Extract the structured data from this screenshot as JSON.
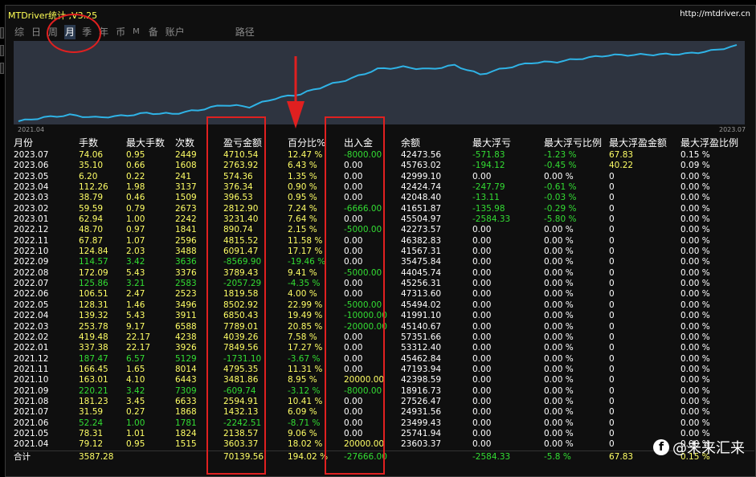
{
  "window": {
    "title": "MTDriver统计 ,V3.25",
    "site": "http://mtdriver.cn"
  },
  "tabs": [
    "综",
    "日",
    "周",
    "月",
    "季",
    "年",
    "币",
    "M",
    "备",
    "账户",
    "路径"
  ],
  "active_tab": "月",
  "chart": {
    "x_start_label": "2021.04",
    "x_end_label": "2023.07",
    "line_color": "#2fb3e6"
  },
  "table": {
    "headers": [
      "月份",
      "手数",
      "最大手数",
      "次数",
      "盈亏金额",
      "百分比%",
      "出入金",
      "余额",
      "最大浮亏",
      "最大浮亏比例",
      "最大浮盈金额",
      "最大浮盈比例"
    ],
    "rows": [
      [
        "2023.07",
        "74.06",
        "0.95",
        "2449",
        "4710.54",
        "12.47 %",
        "-8000.00",
        "42473.56",
        "-571.83",
        "-1.23 %",
        "67.83",
        "0.15 %"
      ],
      [
        "2023.06",
        "35.10",
        "0.66",
        "1608",
        "2763.92",
        "6.43 %",
        "0.00",
        "45763.02",
        "-194.12",
        "-0.45 %",
        "40.22",
        "0.09 %"
      ],
      [
        "2023.05",
        "6.20",
        "0.22",
        "241",
        "574.36",
        "1.35 %",
        "0.00",
        "42999.10",
        "0.00",
        "0.00 %",
        "0",
        "0.00 %"
      ],
      [
        "2023.04",
        "112.26",
        "1.98",
        "3137",
        "376.34",
        "0.90 %",
        "0.00",
        "42424.74",
        "-247.79",
        "-0.61 %",
        "0",
        "0.00 %"
      ],
      [
        "2023.03",
        "38.79",
        "0.46",
        "1509",
        "396.53",
        "0.95 %",
        "0.00",
        "42048.40",
        "-13.11",
        "-0.03 %",
        "0",
        "0.00 %"
      ],
      [
        "2023.02",
        "59.59",
        "0.79",
        "2673",
        "2812.90",
        "7.24 %",
        "-6666.00",
        "41651.87",
        "-135.98",
        "-0.29 %",
        "0",
        "0.00 %"
      ],
      [
        "2023.01",
        "62.94",
        "1.00",
        "2242",
        "3231.40",
        "7.64 %",
        "0.00",
        "45504.97",
        "-2584.33",
        "-5.80 %",
        "0",
        "0.00 %"
      ],
      [
        "2022.12",
        "48.70",
        "0.97",
        "1841",
        "890.74",
        "2.15 %",
        "-5000.00",
        "42273.57",
        "0.00",
        "0.00 %",
        "0",
        "0.00 %"
      ],
      [
        "2022.11",
        "67.87",
        "1.07",
        "2596",
        "4815.52",
        "11.58 %",
        "0.00",
        "46382.83",
        "0.00",
        "0.00 %",
        "0",
        "0.00 %"
      ],
      [
        "2022.10",
        "124.84",
        "2.03",
        "3488",
        "6091.47",
        "17.17 %",
        "0.00",
        "41567.31",
        "0.00",
        "0.00 %",
        "0",
        "0.00 %"
      ],
      [
        "2022.09",
        "114.57",
        "3.42",
        "3636",
        "-8569.90",
        "-19.46 %",
        "0.00",
        "35475.84",
        "0.00",
        "0.00 %",
        "0",
        "0.00 %"
      ],
      [
        "2022.08",
        "172.09",
        "5.43",
        "3376",
        "3789.43",
        "9.41 %",
        "-5000.00",
        "44045.74",
        "0.00",
        "0.00 %",
        "0",
        "0.00 %"
      ],
      [
        "2022.07",
        "125.86",
        "3.21",
        "2583",
        "-2057.29",
        "-4.35 %",
        "0.00",
        "45256.31",
        "0.00",
        "0.00 %",
        "0",
        "0.00 %"
      ],
      [
        "2022.06",
        "106.51",
        "2.47",
        "2523",
        "1819.58",
        "4.00 %",
        "0.00",
        "47313.60",
        "0.00",
        "0.00 %",
        "0",
        "0.00 %"
      ],
      [
        "2022.05",
        "128.31",
        "1.46",
        "3496",
        "8502.92",
        "22.99 %",
        "-5000.00",
        "45494.02",
        "0.00",
        "0.00 %",
        "0",
        "0.00 %"
      ],
      [
        "2022.04",
        "139.32",
        "5.43",
        "3911",
        "6850.43",
        "19.49 %",
        "-10000.00",
        "41991.10",
        "0.00",
        "0.00 %",
        "0",
        "0.00 %"
      ],
      [
        "2022.03",
        "253.78",
        "9.17",
        "6588",
        "7789.01",
        "20.85 %",
        "-20000.00",
        "45140.67",
        "0.00",
        "0.00 %",
        "0",
        "0.00 %"
      ],
      [
        "2022.02",
        "419.48",
        "22.17",
        "4238",
        "4039.26",
        "7.58 %",
        "0.00",
        "57351.66",
        "0.00",
        "0.00 %",
        "0",
        "0.00 %"
      ],
      [
        "2022.01",
        "337.38",
        "22.17",
        "3926",
        "7849.56",
        "17.27 %",
        "0.00",
        "53312.40",
        "0.00",
        "0.00 %",
        "0",
        "0.00 %"
      ],
      [
        "2021.12",
        "187.47",
        "6.57",
        "5129",
        "-1731.10",
        "-3.67 %",
        "0.00",
        "45462.84",
        "0.00",
        "0.00 %",
        "0",
        "0.00 %"
      ],
      [
        "2021.11",
        "166.45",
        "1.65",
        "8014",
        "4795.35",
        "11.31 %",
        "0.00",
        "47193.94",
        "0.00",
        "0.00 %",
        "0",
        "0.00 %"
      ],
      [
        "2021.10",
        "163.01",
        "4.10",
        "6443",
        "3481.86",
        "8.95 %",
        "20000.00",
        "42398.59",
        "0.00",
        "0.00 %",
        "0",
        "0.00 %"
      ],
      [
        "2021.09",
        "220.21",
        "3.42",
        "7309",
        "-609.74",
        "-3.12 %",
        "-8000.00",
        "18916.73",
        "0.00",
        "0.00 %",
        "0",
        "0.00 %"
      ],
      [
        "2021.08",
        "181.23",
        "3.45",
        "6633",
        "2594.91",
        "10.41 %",
        "0.00",
        "27526.47",
        "0.00",
        "0.00 %",
        "0",
        "0.00 %"
      ],
      [
        "2021.07",
        "31.59",
        "0.27",
        "1868",
        "1432.13",
        "6.09 %",
        "0.00",
        "24931.56",
        "0.00",
        "0.00 %",
        "0",
        "0.00 %"
      ],
      [
        "2021.06",
        "52.24",
        "1.00",
        "1781",
        "-2242.51",
        "-8.71 %",
        "0.00",
        "23499.43",
        "0.00",
        "0.00 %",
        "0",
        "0.00 %"
      ],
      [
        "2021.05",
        "78.31",
        "1.01",
        "1824",
        "2138.57",
        "9.06 %",
        "0.00",
        "25741.94",
        "0.00",
        "0.00 %",
        "0",
        "0.00 %"
      ],
      [
        "2021.04",
        "79.12",
        "0.95",
        "1515",
        "3603.37",
        "18.02 %",
        "20000.00",
        "23603.37",
        "0.00",
        "0.00 %",
        "0",
        "0.00 %"
      ]
    ],
    "totals": [
      "合计",
      "3587.28",
      "",
      "",
      "70139.56",
      "194.02 %",
      "-27666.00",
      "",
      "-2584.33",
      "-5.8 %",
      "67.83",
      "0.15 %"
    ]
  },
  "watermark": {
    "icon": "f",
    "text": "@未来汇来"
  },
  "colors": {
    "positive": "#ffff66",
    "negative": "#33dd33",
    "label": "#ffffff",
    "annotation": "#e02020"
  }
}
